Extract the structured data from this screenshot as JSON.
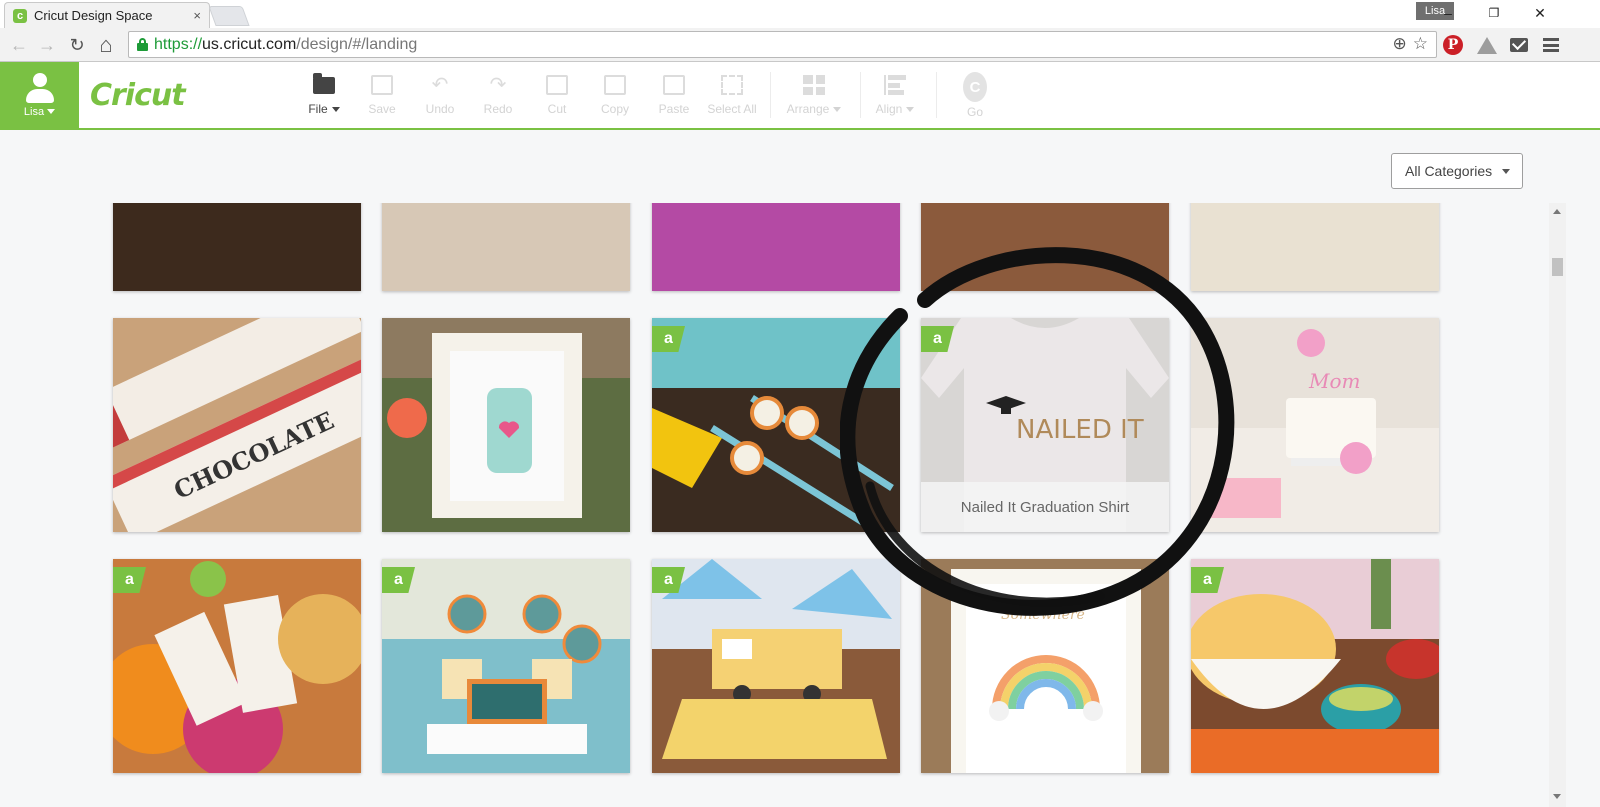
{
  "browser": {
    "tab_title": "Cricut Design Space",
    "tab_close": "×",
    "favicon_letter": "c",
    "profile": "Lisa",
    "win_minimize": "–",
    "win_restore": "❐",
    "win_close": "✕",
    "url_scheme": "https://",
    "url_host": "us.cricut.com",
    "url_path": "/design/#/landing",
    "back": "←",
    "forward": "→",
    "reload": "↻",
    "home": "⌂",
    "zoom_glyph": "⊕",
    "star_glyph": "☆",
    "pinterest_letter": "P"
  },
  "app": {
    "brand": "Cricut",
    "user": "Lisa",
    "brand_color": "#7ac143",
    "toolbar": {
      "file": "File",
      "save": "Save",
      "undo": "Undo",
      "redo": "Redo",
      "cut": "Cut",
      "copy": "Copy",
      "paste": "Paste",
      "select_all": "Select All",
      "arrange": "Arrange",
      "align": "Align",
      "go": "Go",
      "go_letter": "C"
    },
    "category_select": "All Categories"
  },
  "projects": {
    "badge_letter": "a",
    "highlighted_caption": "Nailed It Graduation Shirt",
    "rows": [
      [
        {
          "theme": "dino-party",
          "access": false
        },
        {
          "theme": "craft-supplies",
          "access": false
        },
        {
          "theme": "pink-flowers",
          "access": false
        },
        {
          "theme": "taco-fiesta",
          "access": false
        },
        {
          "theme": "window-party",
          "access": false
        }
      ],
      [
        {
          "theme": "chocolate-wrappers",
          "access": false
        },
        {
          "theme": "mason-jar-frame",
          "access": false
        },
        {
          "theme": "dino-straws",
          "access": true
        },
        {
          "theme": "nailed-it-shirt",
          "access": true
        },
        {
          "theme": "mom-cake",
          "access": false
        }
      ],
      [
        {
          "theme": "fiesta-napkins",
          "access": true
        },
        {
          "theme": "dessertivore-cupcakes",
          "access": true
        },
        {
          "theme": "rv-popup-card",
          "access": true
        },
        {
          "theme": "rainbow-print",
          "access": false
        },
        {
          "theme": "fiesta-bowls",
          "access": true
        }
      ]
    ]
  }
}
